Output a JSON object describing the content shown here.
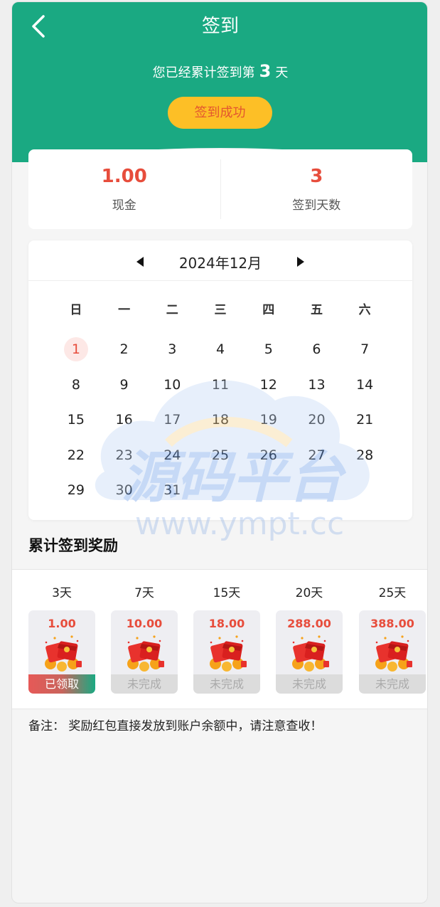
{
  "header": {
    "title": "签到",
    "streak_prefix": "您已经累计签到第",
    "streak_days": "3",
    "streak_suffix": "天",
    "signed_label": "签到成功"
  },
  "stats": {
    "cash_value": "1.00",
    "cash_label": "现金",
    "days_value": "3",
    "days_label": "签到天数"
  },
  "calendar": {
    "month_label": "2024年12月",
    "weekdays": [
      "日",
      "一",
      "二",
      "三",
      "四",
      "五",
      "六"
    ],
    "weeks": [
      [
        "1",
        "2",
        "3",
        "4",
        "5",
        "6",
        "7"
      ],
      [
        "8",
        "9",
        "10",
        "11",
        "12",
        "13",
        "14"
      ],
      [
        "15",
        "16",
        "17",
        "18",
        "19",
        "20",
        "21"
      ],
      [
        "22",
        "23",
        "24",
        "25",
        "26",
        "27",
        "28"
      ],
      [
        "29",
        "30",
        "31",
        "",
        "",
        "",
        ""
      ]
    ],
    "checked_day": "1"
  },
  "watermark": {
    "brand": "源码平台",
    "url": "www.ympt.cc"
  },
  "rewards": {
    "title": "累计签到奖励",
    "items": [
      {
        "day": "3天",
        "amount": "1.00",
        "status": "已领取"
      },
      {
        "day": "7天",
        "amount": "10.00",
        "status": "未完成"
      },
      {
        "day": "15天",
        "amount": "18.00",
        "status": "未完成"
      },
      {
        "day": "20天",
        "amount": "288.00",
        "status": "未完成"
      },
      {
        "day": "25天",
        "amount": "388.00",
        "status": "未完成"
      }
    ]
  },
  "note": "备注：  奖励红包直接发放到账户余额中，请注意查收！",
  "colors": {
    "header_green": "#1aa982",
    "accent_red": "#e74d3c",
    "button_yellow": "#fdbf26"
  }
}
